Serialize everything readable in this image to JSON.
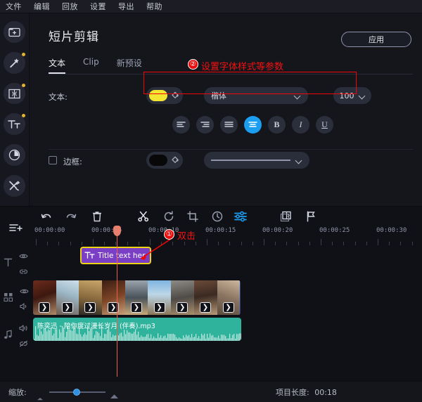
{
  "menubar": {
    "items": [
      {
        "label": "文件",
        "name": "menu-file"
      },
      {
        "label": "编辑",
        "name": "menu-edit"
      },
      {
        "label": "回放",
        "name": "menu-playback"
      },
      {
        "label": "设置",
        "name": "menu-settings"
      },
      {
        "label": "导出",
        "name": "menu-export"
      },
      {
        "label": "帮助",
        "name": "menu-help"
      }
    ]
  },
  "rail": {
    "items": [
      {
        "icon": "add-folder-icon",
        "dot": false
      },
      {
        "icon": "magic-wand-icon",
        "dot": true
      },
      {
        "icon": "transition-icon",
        "dot": true
      },
      {
        "icon": "title-text-icon",
        "dot": true
      },
      {
        "icon": "color-filter-icon",
        "dot": false
      },
      {
        "icon": "tools-icon",
        "dot": false
      }
    ]
  },
  "panel": {
    "title": "短片剪辑",
    "apply_label": "应用",
    "tabs": [
      {
        "label": "文本",
        "active": true
      },
      {
        "label": "Clip",
        "active": false
      },
      {
        "label": "新预设",
        "active": false
      }
    ],
    "text_row": {
      "label": "文本:",
      "color": "#f2e632",
      "font_family": "楷体",
      "font_size": "100"
    },
    "format_buttons": [
      {
        "name": "align-left-button",
        "glyph": "align-left",
        "active": false
      },
      {
        "name": "align-right-button",
        "glyph": "align-right",
        "active": false
      },
      {
        "name": "align-justify-button",
        "glyph": "align-justify",
        "active": false
      },
      {
        "name": "align-center-button",
        "glyph": "align-center",
        "active": true
      },
      {
        "name": "bold-button",
        "glyph": "B",
        "active": false
      },
      {
        "name": "italic-button",
        "glyph": "I",
        "active": false
      },
      {
        "name": "underline-button",
        "glyph": "U",
        "active": false
      }
    ],
    "border_row": {
      "label": "边框:",
      "checked": false,
      "color": "#080808",
      "width_value": ""
    }
  },
  "annotations": [
    {
      "num": "①",
      "text": "双击"
    },
    {
      "num": "②",
      "text": "设置字体样式等参数"
    }
  ],
  "timeline": {
    "toolbar": [
      {
        "name": "undo-icon"
      },
      {
        "name": "redo-icon"
      },
      {
        "name": "delete-icon"
      },
      {
        "name": "cut-scissors-icon"
      },
      {
        "name": "rotate-icon"
      },
      {
        "name": "crop-icon"
      },
      {
        "name": "speed-clock-icon"
      },
      {
        "name": "color-adjust-icon"
      },
      {
        "name": "duplicate-icon"
      },
      {
        "name": "marker-flag-icon"
      }
    ],
    "ruler_labels": [
      "00:00:00",
      "00:00:05",
      "00:00:10",
      "00:00:15",
      "00:00:20",
      "00:00:25",
      "00:00:30"
    ],
    "tracks": [
      {
        "name": "title-track",
        "head_icons": [
          "text-track-icon",
          "eye-icon",
          "link-icon"
        ],
        "clip": {
          "label": "Title text her",
          "icon": "title-text-icon"
        }
      },
      {
        "name": "video-track",
        "head_icons": [
          "video-track-icon",
          "eye-icon",
          "speaker-icon"
        ],
        "clip_count": 9
      },
      {
        "name": "audio-track",
        "head_icons": [
          "music-note-icon",
          "speaker-icon",
          "unlink-icon"
        ],
        "clip": {
          "label": "陈奕迅 - 陪你度过漫长岁月 (伴奏).mp3"
        }
      }
    ],
    "add_track_icon": "add-track-icon"
  },
  "bottom": {
    "zoom_label": "缩放:",
    "project_length_label": "项目长度:",
    "project_length_value": "00:18"
  }
}
